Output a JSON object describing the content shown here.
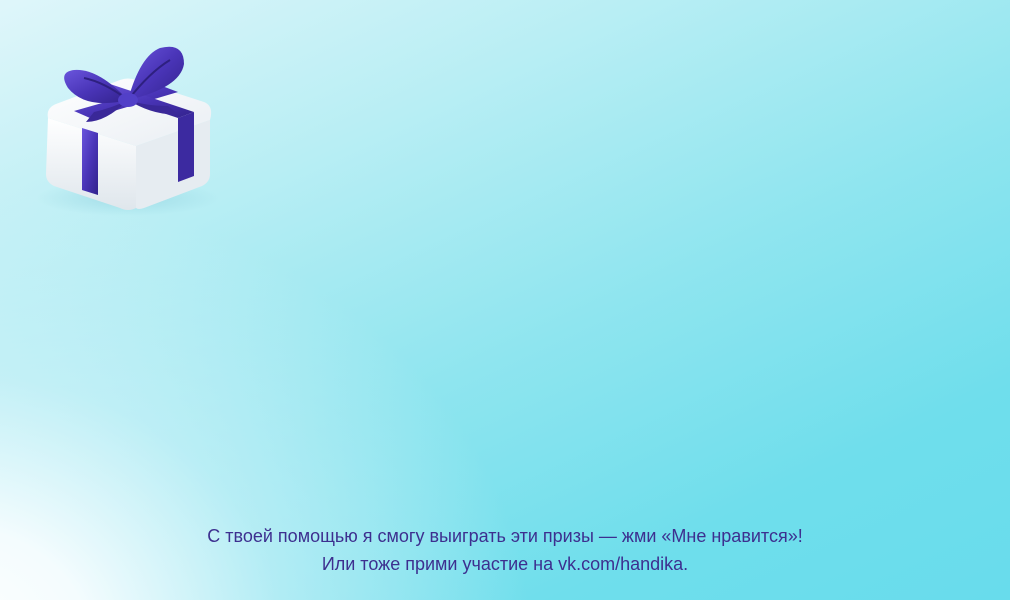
{
  "gift": {
    "icon": "gift-box-icon",
    "box_color": "#f5f7fa",
    "ribbon_color": "#4a35b8"
  },
  "message": {
    "line1": "С твоей помощью я смогу выиграть эти призы — жми «Мне нравится»!",
    "line2": "Или тоже прими участие на vk.com/handika.",
    "text_color": "#3d2f8f"
  },
  "background": {
    "accent": "#68dcec",
    "highlight": "#ffffff"
  }
}
